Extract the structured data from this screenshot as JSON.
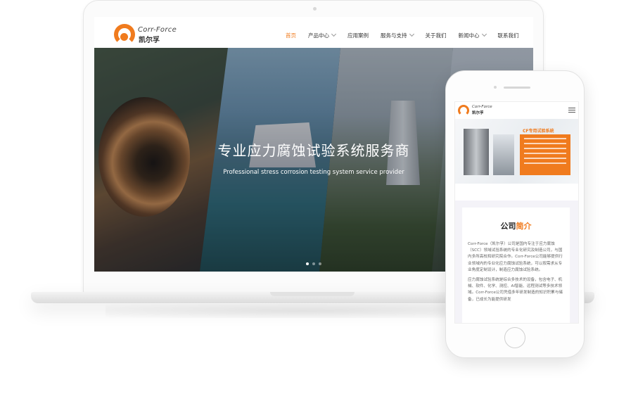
{
  "laptop": {
    "logo": {
      "en": "Corr-Force",
      "cn": "凯尔孚"
    },
    "nav": [
      {
        "label": "首页",
        "active": true,
        "dropdown": false
      },
      {
        "label": "产品中心",
        "active": false,
        "dropdown": true
      },
      {
        "label": "应用案例",
        "active": false,
        "dropdown": false
      },
      {
        "label": "服务与支持",
        "active": false,
        "dropdown": true
      },
      {
        "label": "关于我们",
        "active": false,
        "dropdown": false
      },
      {
        "label": "新闻中心",
        "active": false,
        "dropdown": true
      },
      {
        "label": "联系我们",
        "active": false,
        "dropdown": false
      }
    ],
    "banner": {
      "title": "专业应力腐蚀试验系统服务商",
      "subtitle": "Professional stress corrosion testing system service provider",
      "slides": 3,
      "active_slide": 1
    }
  },
  "phone": {
    "logo": {
      "en": "Corr-Force",
      "cn": "凯尔孚"
    },
    "banner_title": "CF专用试验系统",
    "intro": {
      "title_a": "公司",
      "title_b": "简介",
      "p1": "Corr-Force（凯尔孚）公司是国内专注于应力腐蚀（SCC）领域试验系统的专业化研究及制造公司，与国内多所高校和研究院合作。Corr-Force公司能够提供行业领域内的专业化应力腐蚀试验系统，可以按需求从专业角度定制设计，制造应力腐蚀试验系统。",
      "p2": "应力腐蚀试验系统是综合多技术的设备，包含电子、机械、软件、化学、测控、AI智能、远程测试等多技术领域。Corr-Force公司凭借多年研发制造的知识积累与储备，已成长为能提供研发"
    }
  },
  "colors": {
    "accent": "#f07b1e"
  }
}
